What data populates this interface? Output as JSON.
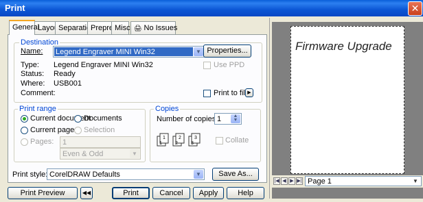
{
  "window": {
    "title": "Print"
  },
  "tabs": [
    {
      "label": "General"
    },
    {
      "label": "Layout"
    },
    {
      "label": "Separations"
    },
    {
      "label": "Prepress"
    },
    {
      "label": "Misc"
    },
    {
      "label": "No Issues"
    }
  ],
  "destination": {
    "legend": "Destination",
    "name_label": "Name:",
    "name_value": "Legend Engraver MINI Win32",
    "properties_button": "Properties...",
    "type_label": "Type:",
    "type_value": "Legend Engraver MINI Win32",
    "status_label": "Status:",
    "status_value": "Ready",
    "where_label": "Where:",
    "where_value": "USB001",
    "comment_label": "Comment:",
    "use_ppd_label": "Use PPD",
    "print_to_file_label": "Print to file"
  },
  "print_range": {
    "legend": "Print range",
    "current_document": "Current document",
    "documents": "Documents",
    "current_page": "Current page",
    "selection": "Selection",
    "pages_label": "Pages:",
    "pages_value": "1",
    "even_odd": "Even & Odd"
  },
  "copies": {
    "legend": "Copies",
    "number_label": "Number of copies:",
    "number_value": "1",
    "collate_label": "Collate"
  },
  "print_style": {
    "label": "Print style:",
    "value": "CorelDRAW Defaults",
    "save_as_button": "Save As..."
  },
  "buttons": {
    "preview": "Print Preview",
    "print": "Print",
    "cancel": "Cancel",
    "apply": "Apply",
    "help": "Help"
  },
  "preview": {
    "page_text": "Firmware Upgrade",
    "page_selector": "Page 1"
  }
}
